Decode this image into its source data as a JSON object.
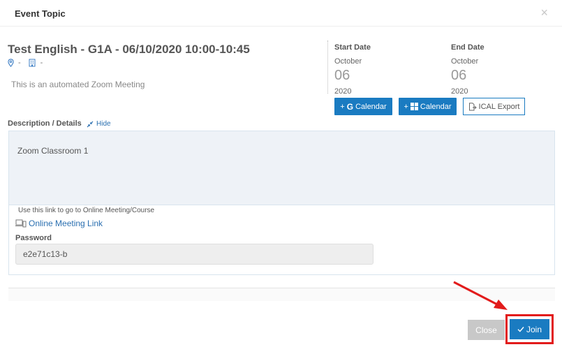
{
  "modal": {
    "title": "Event Topic",
    "close_symbol": "×"
  },
  "event": {
    "title": "Test English - G1A - 06/10/2020 10:00-10:45",
    "location": "-",
    "room": "-",
    "summary": "This is an automated Zoom Meeting"
  },
  "start_date": {
    "label": "Start Date",
    "month": "October",
    "day": "06",
    "year": "2020"
  },
  "end_date": {
    "label": "End Date",
    "month": "October",
    "day": "06",
    "year": "2020"
  },
  "buttons": {
    "google_calendar": "Calendar",
    "windows_calendar": "Calendar",
    "ical_export": "ICAL Export",
    "plus": "+",
    "google_letter": "G",
    "close": "Close",
    "join": "Join"
  },
  "description": {
    "label": "Description / Details",
    "hide": "Hide",
    "text": "Zoom Classroom 1"
  },
  "online": {
    "hint": "Use this link to go to Online Meeting/Course",
    "link_label": "Online Meeting Link",
    "password_label": "Password",
    "password_value": "e2e71c13-b"
  },
  "colors": {
    "primary": "#1a7bc1",
    "highlight": "#e21b1b",
    "muted_button": "#c8c8c8"
  },
  "icons": [
    "close-icon",
    "location-pin-icon",
    "building-icon",
    "google-icon",
    "windows-icon",
    "file-export-icon",
    "compress-icon",
    "devices-icon",
    "check-icon"
  ]
}
